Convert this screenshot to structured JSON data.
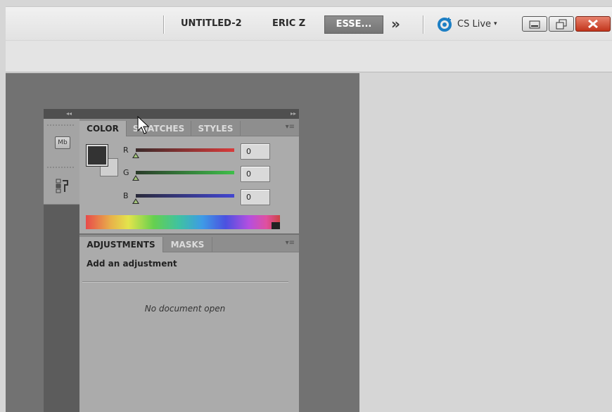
{
  "appbar": {
    "tabs": [
      "UNTITLED-2",
      "ERIC Z"
    ],
    "active_workspace": "ESSE...",
    "overflow": "»",
    "cslive_label": "CS Live",
    "cslive_caret": "▾"
  },
  "colors": {
    "accent_blue": "#1d7fc4",
    "close_red": "#c2351c"
  },
  "icons": {
    "mini_bridge": "Mb",
    "history": "history-icon"
  },
  "color_panel": {
    "tabs": [
      "COLOR",
      "SWATCHES",
      "STYLES"
    ],
    "channels": [
      {
        "label": "R",
        "value": "0",
        "color": "#d83a3a"
      },
      {
        "label": "G",
        "value": "0",
        "color": "#3fbf4a"
      },
      {
        "label": "B",
        "value": "0",
        "color": "#4246d1"
      }
    ]
  },
  "adjustments_panel": {
    "tabs": [
      "ADJUSTMENTS",
      "MASKS"
    ],
    "title": "Add an adjustment",
    "empty_message": "No document open"
  },
  "panel_header": {
    "collapse": "◂◂",
    "expand": "▸▸"
  }
}
